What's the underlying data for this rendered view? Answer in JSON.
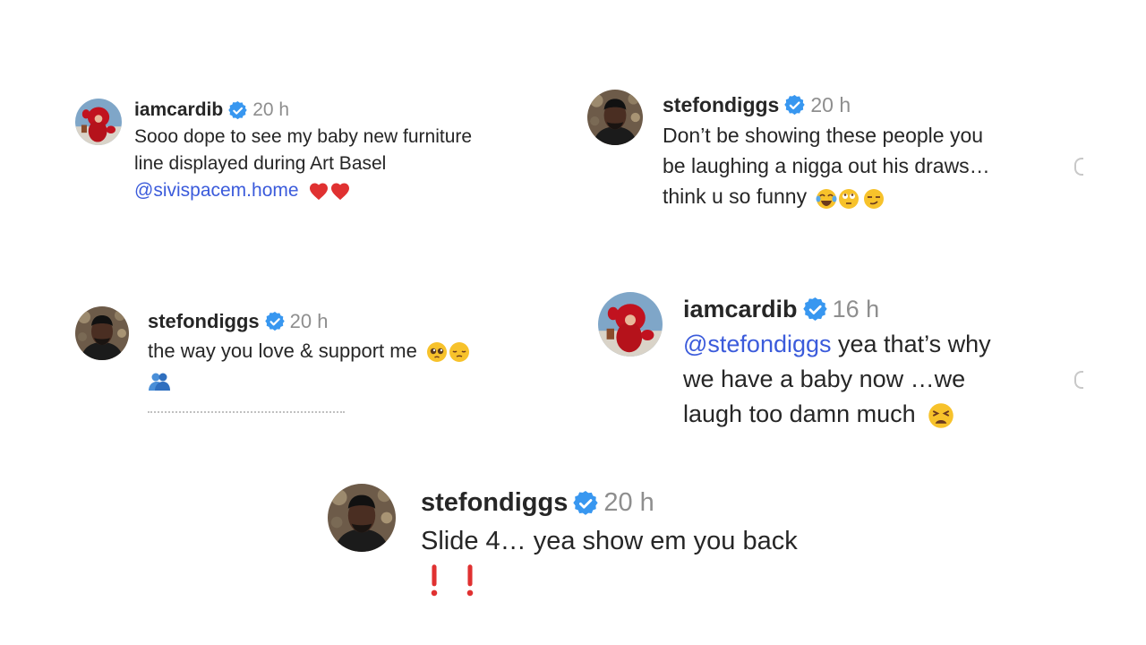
{
  "comments": [
    {
      "username": "iamcardib",
      "time": "20 h",
      "lines": [
        "Sooo dope to see my baby new furniture",
        "line displayed during Art Basel"
      ],
      "mention": "@sivispacem.home",
      "emoji": [
        "red-heart",
        "red-heart"
      ]
    },
    {
      "username": "stefondiggs",
      "time": "20 h",
      "lines": [
        "Don’t be showing these people you",
        "be laughing a nigga out his draws…",
        "think u so funny"
      ],
      "emoji": [
        "face-with-tears-of-joy",
        "face-with-rolling-eyes",
        "smirking-face"
      ]
    },
    {
      "username": "stefondiggs",
      "time": "20 h",
      "lines": [
        "the way you love & support me"
      ],
      "emoji": [
        "pleading-face",
        "pensive-face",
        "people-hugging"
      ]
    },
    {
      "username": "iamcardib",
      "time": "16 h",
      "mention": "@stefondiggs",
      "lines": [
        " yea that’s why",
        "we have a baby now …we",
        "laugh too damn much"
      ],
      "emoji": [
        "weary-face"
      ]
    },
    {
      "username": "stefondiggs",
      "time": "20 h",
      "lines": [
        "Slide 4… yea show em you back"
      ],
      "emoji": [
        "exclamation-mark",
        "exclamation-mark"
      ]
    }
  ],
  "colors": {
    "verified": "#3897f0",
    "mention": "#3b5bdb",
    "timestamp": "#8e8e8e",
    "exclamation": "#e03131"
  }
}
